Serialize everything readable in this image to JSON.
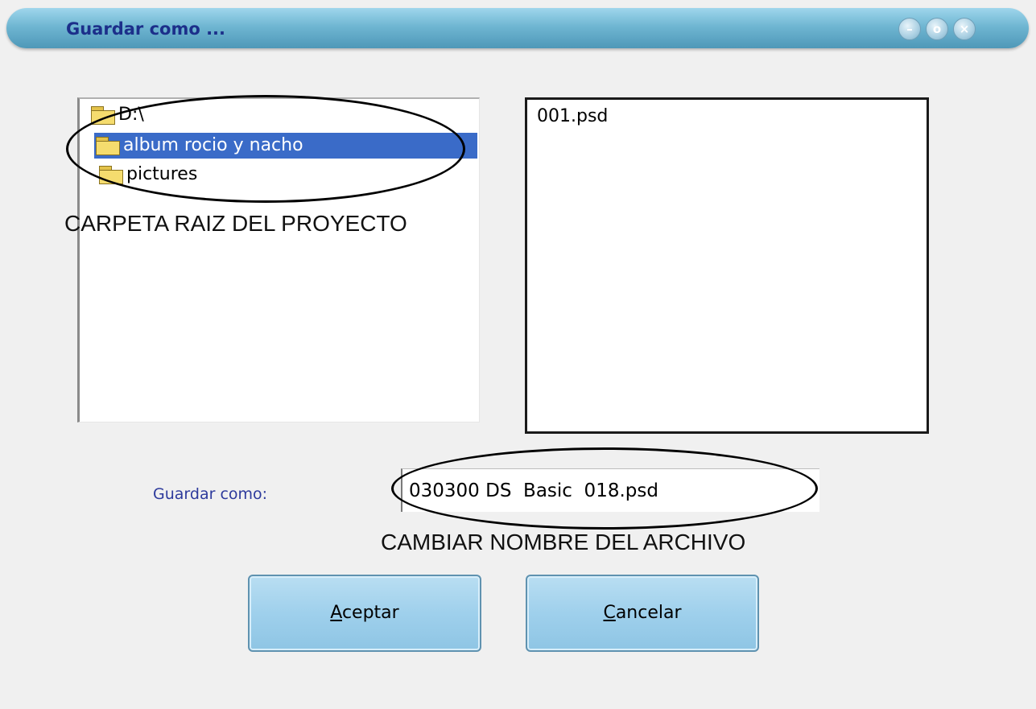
{
  "window": {
    "title": "Guardar como ...",
    "controls": {
      "minimize": "–",
      "maximize": "o",
      "close": "×"
    }
  },
  "tree": {
    "items": [
      {
        "label": "D:\\",
        "icon": "open-folder-icon",
        "selected": false
      },
      {
        "label": "album rocio y nacho",
        "icon": "open-folder-icon",
        "selected": true
      },
      {
        "label": "pictures",
        "icon": "folder-icon",
        "selected": false
      }
    ]
  },
  "files": {
    "items": [
      "001.psd"
    ]
  },
  "annotations": {
    "folder_caption": "CARPETA RAIZ DEL PROYECTO",
    "filename_caption": "CAMBIAR NOMBRE DEL ARCHIVO"
  },
  "save_as": {
    "label": "Guardar como:",
    "value": "030300 DS  Basic  018.psd"
  },
  "buttons": {
    "accept": {
      "accel": "A",
      "rest": "ceptar"
    },
    "cancel": {
      "accel": "C",
      "rest": "ancelar"
    }
  },
  "colors": {
    "title_bar": "#6fb6d2",
    "title_text": "#1c2f8a",
    "selection": "#3a6bc8",
    "button_fill": "#9fd0ec",
    "label_text": "#2d3a9c"
  }
}
